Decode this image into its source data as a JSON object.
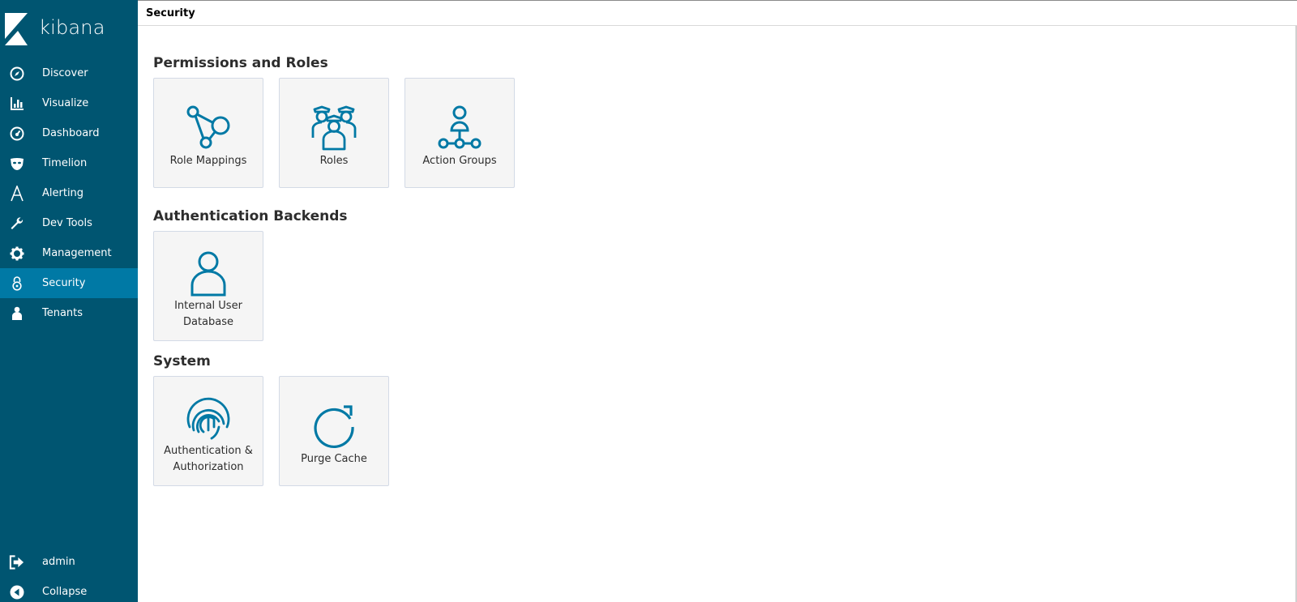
{
  "brand": {
    "name": "kibana"
  },
  "sidebar": {
    "items": [
      {
        "label": "Discover",
        "icon": "compass-icon"
      },
      {
        "label": "Visualize",
        "icon": "bar-chart-icon"
      },
      {
        "label": "Dashboard",
        "icon": "gauge-icon"
      },
      {
        "label": "Timelion",
        "icon": "mask-icon"
      },
      {
        "label": "Alerting",
        "icon": "alerting-a-icon"
      },
      {
        "label": "Dev Tools",
        "icon": "wrench-icon"
      },
      {
        "label": "Management",
        "icon": "gear-icon"
      },
      {
        "label": "Security",
        "icon": "lock-icon",
        "active": true
      },
      {
        "label": "Tenants",
        "icon": "person-icon"
      }
    ],
    "bottom": [
      {
        "label": "admin",
        "icon": "logout-icon"
      },
      {
        "label": "Collapse",
        "icon": "collapse-icon"
      }
    ]
  },
  "header": {
    "breadcrumb": "Security"
  },
  "sections": {
    "permissions": {
      "title": "Permissions and Roles",
      "tiles": [
        {
          "label": "Role Mappings",
          "icon": "role-mappings-icon"
        },
        {
          "label": "Roles",
          "icon": "roles-icon"
        },
        {
          "label": "Action Groups",
          "icon": "action-groups-icon"
        }
      ]
    },
    "auth_backends": {
      "title": "Authentication Backends",
      "tiles": [
        {
          "label_line1": "Internal User",
          "label_line2": "Database",
          "icon": "user-icon"
        }
      ]
    },
    "system": {
      "title": "System",
      "tiles": [
        {
          "label_line1": "Authentication &",
          "label_line2": "Authorization",
          "icon": "fingerprint-icon"
        },
        {
          "label": "Purge Cache",
          "icon": "refresh-icon"
        }
      ]
    }
  },
  "colors": {
    "sidebar_bg": "#005571",
    "sidebar_active": "#0079a5",
    "tile_icon": "#0079a5",
    "tile_bg": "#f5f5f5"
  }
}
